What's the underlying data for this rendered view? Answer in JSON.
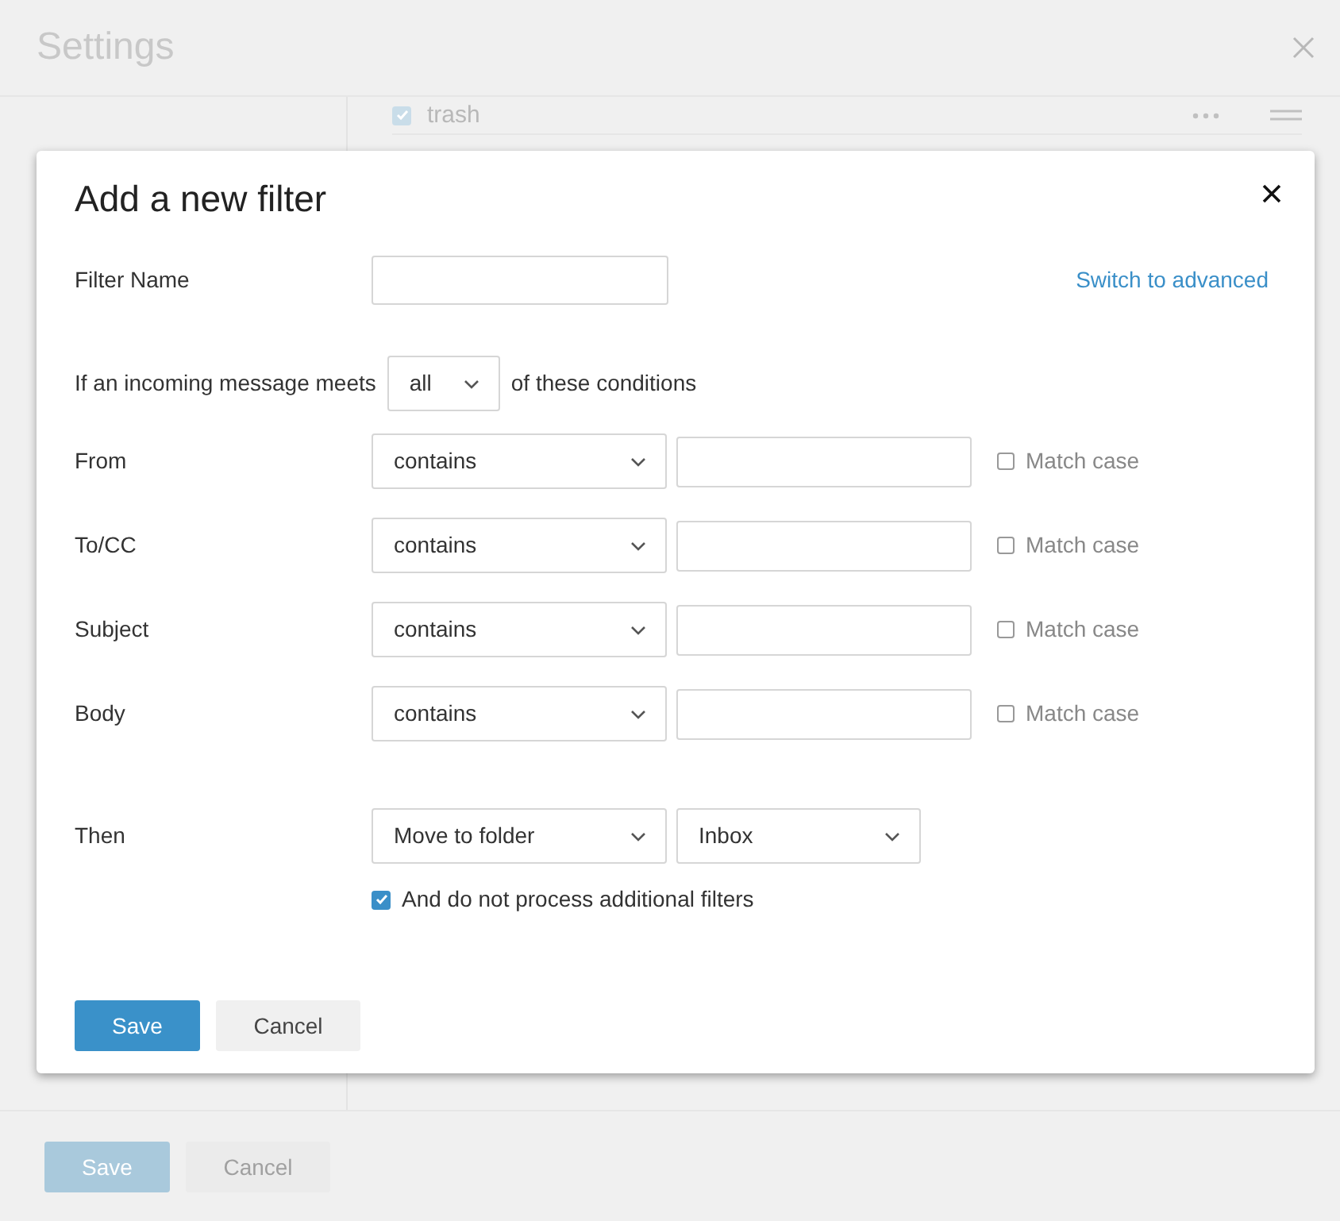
{
  "background": {
    "title": "Settings",
    "list_item": {
      "label": "trash",
      "checked": true
    },
    "buttons": [
      {
        "label": "Save",
        "kind": "primary",
        "disabled": true
      },
      {
        "label": "Cancel",
        "kind": "secondary",
        "disabled": true
      }
    ]
  },
  "dialog": {
    "title": "Add a new filter",
    "filter_name": {
      "label": "Filter Name"
    },
    "advanced_link": "Switch to advanced",
    "match": {
      "prefix": "If an incoming message meets",
      "value": "all",
      "suffix": "of these conditions"
    },
    "conditions": [
      {
        "field": "From",
        "operator": "contains",
        "match_case_label": "Match case",
        "match_case": false
      },
      {
        "field": "To/CC",
        "operator": "contains",
        "match_case_label": "Match case",
        "match_case": false
      },
      {
        "field": "Subject",
        "operator": "contains",
        "match_case_label": "Match case",
        "match_case": false
      },
      {
        "field": "Body",
        "operator": "contains",
        "match_case_label": "Match case",
        "match_case": false
      }
    ],
    "action": {
      "label": "Then",
      "operator": "Move to folder",
      "folder": "Inbox"
    },
    "stop_option": {
      "label": "And do not process additional filters",
      "checked": true
    },
    "buttons": [
      {
        "label": "Save",
        "kind": "primary"
      },
      {
        "label": "Cancel",
        "kind": "secondary"
      }
    ]
  }
}
